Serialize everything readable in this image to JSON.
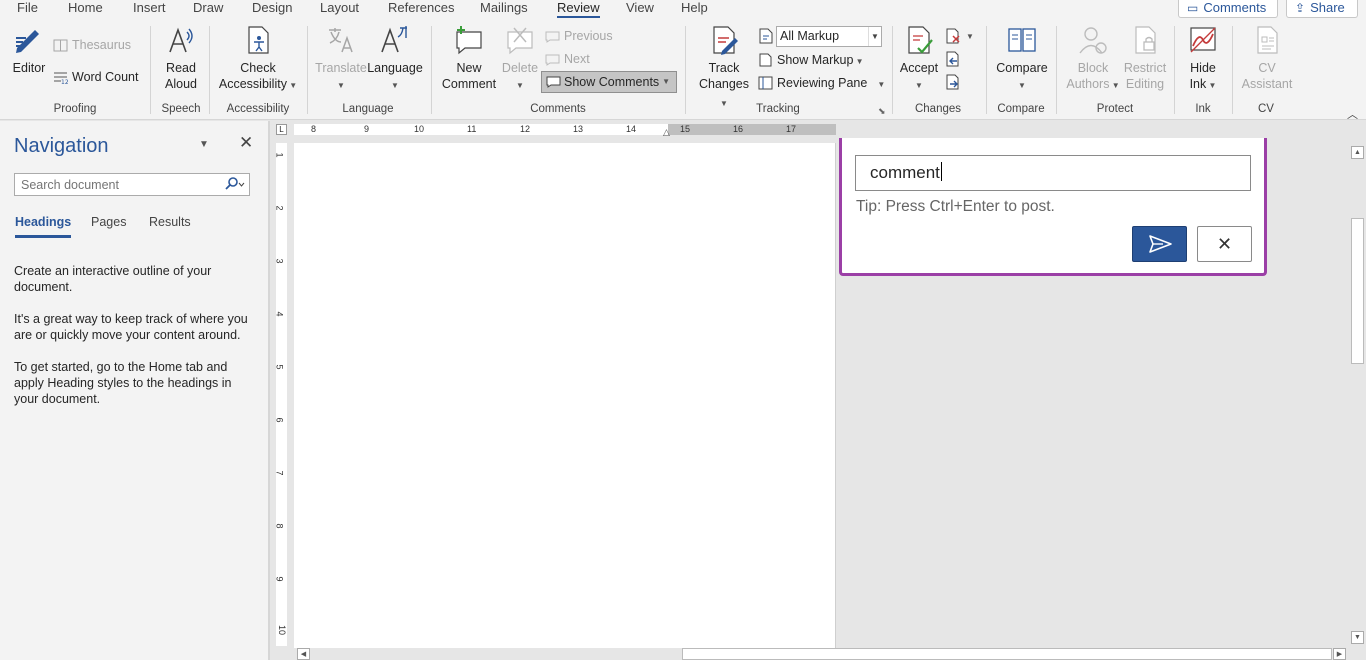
{
  "menu": {
    "tabs": [
      "File",
      "Home",
      "Insert",
      "Draw",
      "Design",
      "Layout",
      "References",
      "Mailings",
      "Review",
      "View",
      "Help"
    ],
    "active": "Review",
    "comments_btn": "Comments",
    "share_btn": "Share"
  },
  "ribbon": {
    "proofing": {
      "editor": "Editor",
      "thesaurus": "Thesaurus",
      "word_count": "Word Count",
      "label": "Proofing"
    },
    "speech": {
      "read_aloud_1": "Read",
      "read_aloud_2": "Aloud",
      "label": "Speech"
    },
    "accessibility": {
      "check_1": "Check",
      "check_2": "Accessibility",
      "label": "Accessibility"
    },
    "language": {
      "translate": "Translate",
      "language": "Language",
      "label": "Language"
    },
    "comments": {
      "new_1": "New",
      "new_2": "Comment",
      "delete": "Delete",
      "previous": "Previous",
      "next": "Next",
      "show_comments": "Show Comments",
      "label": "Comments"
    },
    "tracking": {
      "track_1": "Track",
      "track_2": "Changes",
      "markup_value": "All Markup",
      "show_markup": "Show Markup",
      "reviewing_pane": "Reviewing Pane",
      "label": "Tracking"
    },
    "changes": {
      "accept": "Accept",
      "label": "Changes"
    },
    "compare": {
      "compare": "Compare",
      "label": "Compare"
    },
    "protect": {
      "block_1": "Block",
      "block_2": "Authors",
      "restrict_1": "Restrict",
      "restrict_2": "Editing",
      "label": "Protect"
    },
    "ink": {
      "hide_1": "Hide",
      "hide_2": "Ink",
      "label": "Ink"
    },
    "cv": {
      "cv_1": "CV",
      "cv_2": "Assistant",
      "label": "CV"
    }
  },
  "navigation": {
    "title": "Navigation",
    "search_placeholder": "Search document",
    "tabs": [
      "Headings",
      "Pages",
      "Results"
    ],
    "active_tab": "Headings",
    "paragraphs": [
      "Create an interactive outline of your document.",
      "It's a great way to keep track of where you are or quickly move your content around.",
      "To get started, go to the Home tab and apply Heading styles to the headings in your document."
    ]
  },
  "ruler": {
    "h_numbers": [
      "8",
      "9",
      "10",
      "11",
      "12",
      "13",
      "14",
      "15",
      "16",
      "17"
    ],
    "v_numbers": [
      "1",
      "2",
      "3",
      "4",
      "5",
      "6",
      "7",
      "8",
      "9",
      "10"
    ]
  },
  "comment": {
    "input_value": "comment",
    "tip": "Tip: Press Ctrl+Enter to post."
  },
  "colors": {
    "accent": "#2b579a",
    "comment_border": "#9b3fa6"
  }
}
